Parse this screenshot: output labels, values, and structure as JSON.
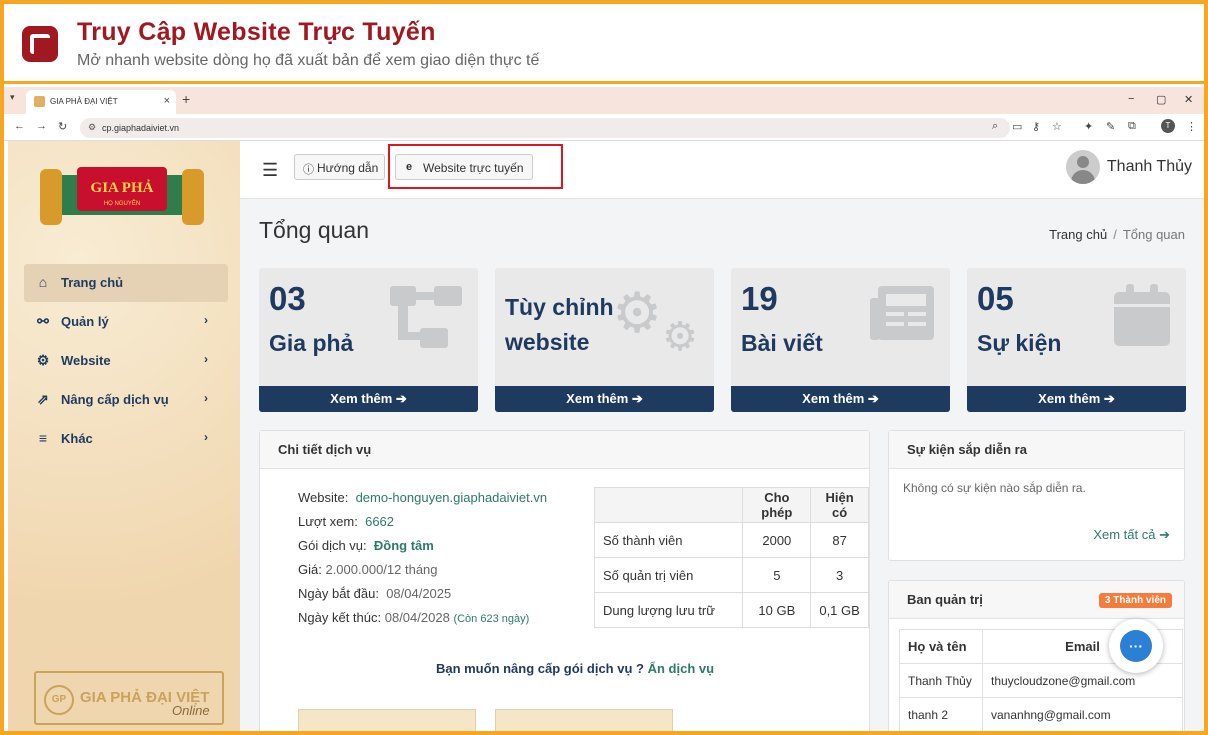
{
  "banner": {
    "title": "Truy Cập Website Trực Tuyến",
    "subtitle": "Mở nhanh website dòng họ đã xuất bản để xem giao diện thực tế"
  },
  "browser": {
    "tab_title": "GIA PHẢ ĐẠI VIỆT",
    "url": "cp.giaphadaiviet.vn",
    "profile_initial": "T"
  },
  "sidebar": {
    "logo_text": "GIA PHẢ",
    "logo_sub": "HỌ NGUYỄN",
    "items": [
      {
        "label": "Trang chủ",
        "icon": "home-icon"
      },
      {
        "label": "Quản lý",
        "icon": "network-icon"
      },
      {
        "label": "Website",
        "icon": "gear-icon"
      },
      {
        "label": "Nâng cấp dịch vụ",
        "icon": "upgrade-icon"
      },
      {
        "label": "Khác",
        "icon": "menu-icon"
      }
    ],
    "footer_badge": "GP",
    "footer_brand": "GIA PHẢ ĐẠI VIỆT",
    "footer_online": "Online"
  },
  "topbar": {
    "guide_label": "Hướng dẫn",
    "website_label": "Website trực tuyến",
    "user_name": "Thanh Thủy"
  },
  "page": {
    "title": "Tổng quan",
    "breadcrumb_home": "Trang chủ",
    "breadcrumb_current": "Tổng quan"
  },
  "cards": [
    {
      "num": "03",
      "label": "Gia phả",
      "more": "Xem thêm"
    },
    {
      "label_line1": "Tùy chỉnh",
      "label_line2": "website",
      "more": "Xem thêm"
    },
    {
      "num": "19",
      "label": "Bài viết",
      "more": "Xem thêm"
    },
    {
      "num": "05",
      "label": "Sự kiện",
      "more": "Xem thêm"
    }
  ],
  "service": {
    "title": "Chi tiết dịch vụ",
    "website_label": "Website:",
    "website_value": "demo-honguyen.giaphadaiviet.vn",
    "views_label": "Lượt xem:",
    "views_value": "6662",
    "plan_label": "Gói dịch vụ:",
    "plan_value": "Đồng tâm",
    "price_label": "Giá:",
    "price_value": "2.000.000/12 tháng",
    "start_label": "Ngày bắt đầu:",
    "start_value": "08/04/2025",
    "end_label": "Ngày kết thúc:",
    "end_value": "08/04/2028",
    "remaining": "(Còn 623 ngày)",
    "table_headers": [
      "",
      "Cho phép",
      "Hiện có"
    ],
    "table_rows": [
      [
        "Số thành viên",
        "2000",
        "87"
      ],
      [
        "Số quản trị viên",
        "5",
        "3"
      ],
      [
        "Dung lượng lưu trữ",
        "10 GB",
        "0,1 GB"
      ]
    ],
    "upgrade_text": "Bạn muốn nâng cấp gói dịch vụ ?",
    "upgrade_link": "Ẩn dịch vụ"
  },
  "events": {
    "title": "Sự kiện sắp diễn ra",
    "empty": "Không có sự kiện nào sắp diễn ra.",
    "see_all": "Xem tất cả"
  },
  "admins": {
    "title": "Ban quản trị",
    "badge": "3 Thành viên",
    "headers": [
      "Họ và tên",
      "Email"
    ],
    "rows": [
      [
        "Thanh Thủy",
        "thuycloudzone@gmail.com"
      ],
      [
        "thanh 2",
        "vananhng@gmail.com"
      ]
    ]
  }
}
